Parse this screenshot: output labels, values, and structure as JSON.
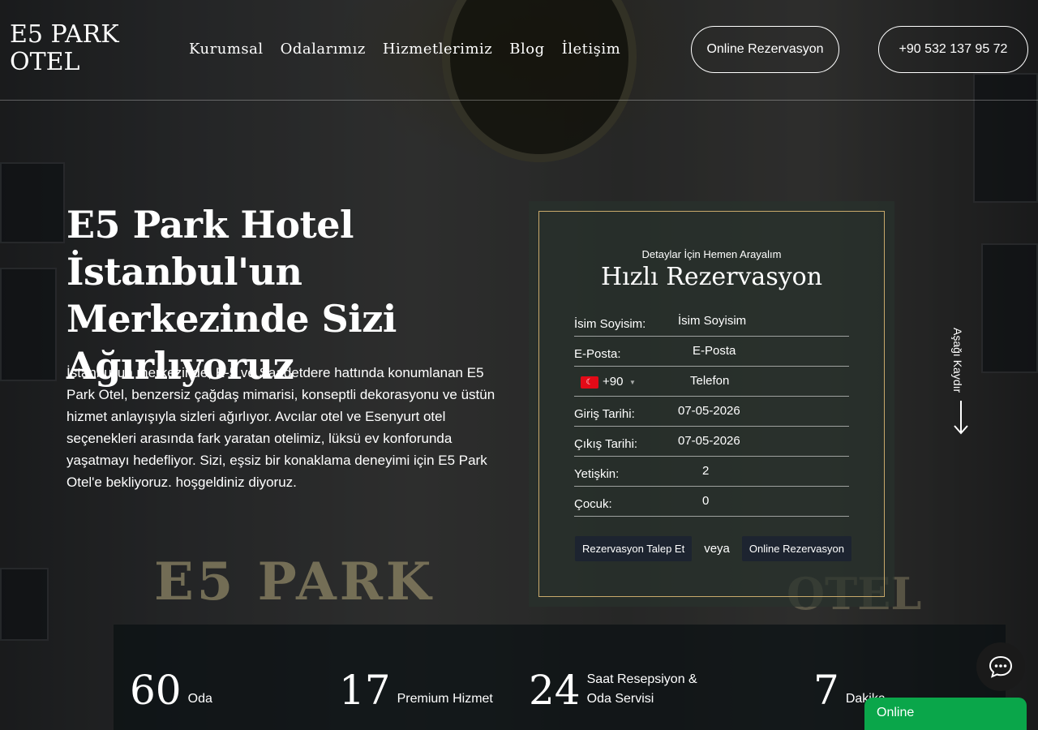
{
  "header": {
    "logo_line1": "E5 PARK",
    "logo_line2": "OTEL",
    "nav": [
      "Kurumsal",
      "Odalarımız",
      "Hizmetlerimiz",
      "Blog",
      "İletişim"
    ],
    "reservation_button": "Online Rezervasyon",
    "phone_button": "+90 532 137 95 72"
  },
  "hero": {
    "title": "E5 Park Hotel İstanbul'un Merkezinde Sizi Ağırlıyoruz",
    "text": "İstanbul'un merkezinde, E-5 ve Saadetdere hattında konumlanan E5 Park Otel, benzersiz çağdaş mimarisi, konseptli dekorasyonu ve üstün hizmet anlayışıyla sizleri ağırlıyor. Avcılar otel ve Esenyurt otel seçenekleri arasında fark yaratan otelimiz, lüksü ev konforunda yaşatmayı hedefliyor. Sizi, eşsiz bir konaklama deneyimi için E5 Park Otel'e bekliyoruz. hoşgeldiniz diyoruz."
  },
  "reservation": {
    "subtitle": "Detaylar İçin Hemen Arayalım",
    "title": "Hızlı Rezervasyon",
    "name_label": "İsim Soyisim:",
    "name_placeholder": "İsim Soyisim",
    "email_label": "E-Posta:",
    "email_placeholder": "E-Posta",
    "phone_code": "+90",
    "phone_placeholder": "Telefon",
    "checkin_label": "Giriş Tarihi:",
    "checkin_value": "07-05-2026",
    "checkout_label": "Çıkış Tarihi:",
    "checkout_value": "07-05-2026",
    "adult_label": "Yetişkin:",
    "adult_value": "2",
    "child_label": "Çocuk:",
    "child_value": "0",
    "request_button": "Rezervasyon Talep Et",
    "or_text": "veya",
    "online_button": "Online Rezervasyon"
  },
  "scroll_text": "Aşağı Kaydır",
  "stats": [
    {
      "num": "60",
      "label": "Oda"
    },
    {
      "num": "17",
      "label": "Premium Hizmet"
    },
    {
      "num": "24",
      "label": "Saat Resepsiyon & Oda Servisi"
    },
    {
      "num": "7",
      "label": "Dakika"
    }
  ],
  "background_sign": "E5 PARK",
  "background_sign2": "OTEL",
  "chat": {
    "online_label": "Online"
  },
  "colors": {
    "panel_border": "#c8a96b",
    "online_green": "#0aa64a",
    "flag_red": "#e30a17"
  }
}
